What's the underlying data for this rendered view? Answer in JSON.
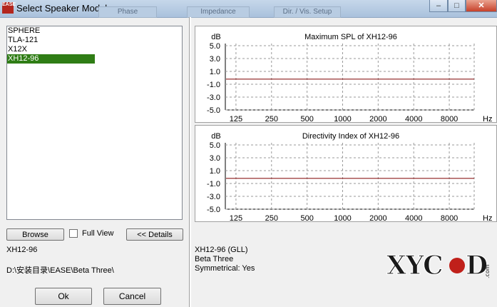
{
  "window": {
    "icon_text": "EASE",
    "title": "Select Speaker Model",
    "bg_tabs": [
      "Phase",
      "Impedance",
      "Dir. / Vis. Setup"
    ],
    "minimize": "–",
    "maximize": "□",
    "close": "✕"
  },
  "speaker_list": {
    "items": [
      "SPHERE",
      "TLA-121",
      "X12X",
      "XH12-96"
    ],
    "selected_index": 3
  },
  "buttons": {
    "browse": "Browse",
    "full_view": "Full View",
    "details": "<< Details",
    "ok": "Ok",
    "cancel": "Cancel"
  },
  "full_view_checked": false,
  "selected_name": "XH12-96",
  "path": "D:\\安装目录\\EASE\\Beta Three\\",
  "details": {
    "line1": "XH12-96 (GLL)",
    "line2": "Beta Three",
    "line3": "Symmetrical: Yes"
  },
  "watermark": "XYCAD.com",
  "chart_data": [
    {
      "type": "line",
      "title": "Maximum SPL of XH12-96",
      "ylabel": "dB",
      "xlabel": "Hz",
      "x": [
        "125",
        "250",
        "500",
        "1000",
        "2000",
        "4000",
        "8000"
      ],
      "yticks": [
        "5.0",
        "3.0",
        "1.0",
        "-1.0",
        "-3.0",
        "-5.0"
      ],
      "ylim": [
        -5.0,
        5.0
      ],
      "series": [
        {
          "values": [
            -0.2,
            -0.2,
            -0.2,
            -0.2,
            -0.2,
            -0.2,
            -0.2
          ],
          "color": "#8b1a1a"
        }
      ],
      "grid": true
    },
    {
      "type": "line",
      "title": "Directivity Index of XH12-96",
      "ylabel": "dB",
      "xlabel": "Hz",
      "x": [
        "125",
        "250",
        "500",
        "1000",
        "2000",
        "4000",
        "8000"
      ],
      "yticks": [
        "5.0",
        "3.0",
        "1.0",
        "-1.0",
        "-3.0",
        "-5.0"
      ],
      "ylim": [
        -5.0,
        5.0
      ],
      "series": [
        {
          "values": [
            -0.2,
            -0.2,
            -0.2,
            -0.2,
            -0.2,
            -0.2,
            -0.2
          ],
          "color": "#8b1a1a"
        }
      ],
      "grid": true
    }
  ]
}
